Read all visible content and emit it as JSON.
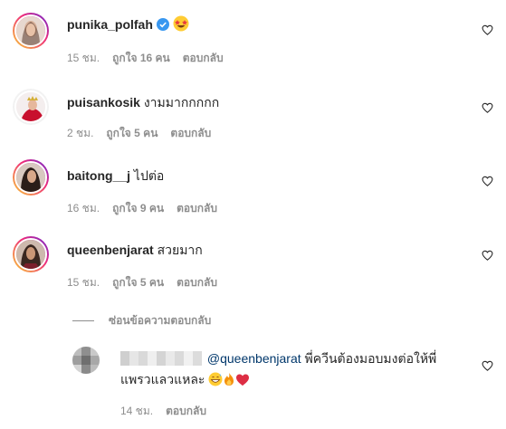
{
  "comments": [
    {
      "username": "punika_polfah",
      "verified": true,
      "text": "",
      "emoji": "star-struck-emoji",
      "time": "15 ชม.",
      "likes": "ถูกใจ 16 คน",
      "reply": "ตอบกลับ"
    },
    {
      "username": "puisankosik",
      "text": "งามมากกกกก",
      "time": "2 ชม.",
      "likes": "ถูกใจ 5 คน",
      "reply": "ตอบกลับ"
    },
    {
      "username": "baitong__j",
      "text": "ไปต่อ",
      "time": "16 ชม.",
      "likes": "ถูกใจ 9 คน",
      "reply": "ตอบกลับ"
    },
    {
      "username": "queenbenjarat",
      "text": "สวยมาก",
      "time": "15 ชม.",
      "likes": "ถูกใจ 5 คน",
      "reply": "ตอบกลับ"
    }
  ],
  "hide_replies": "ซ่อนข้อความตอบกลับ",
  "reply_comment": {
    "mention": "@queenbenjarat",
    "text_line1": "พี่ควีนต้องมอบมงต่อให้พี่",
    "text_line2": "แพรวแลวแหละ",
    "emojis": [
      "grinning-sweat-emoji",
      "fire-emoji",
      "red-heart-emoji"
    ],
    "time": "14 ชม.",
    "reply": "ตอบกลับ"
  },
  "colors": {
    "text": "#262626",
    "secondary": "#8e8e8e",
    "mention": "#00376b",
    "verified": "#3897f0"
  }
}
